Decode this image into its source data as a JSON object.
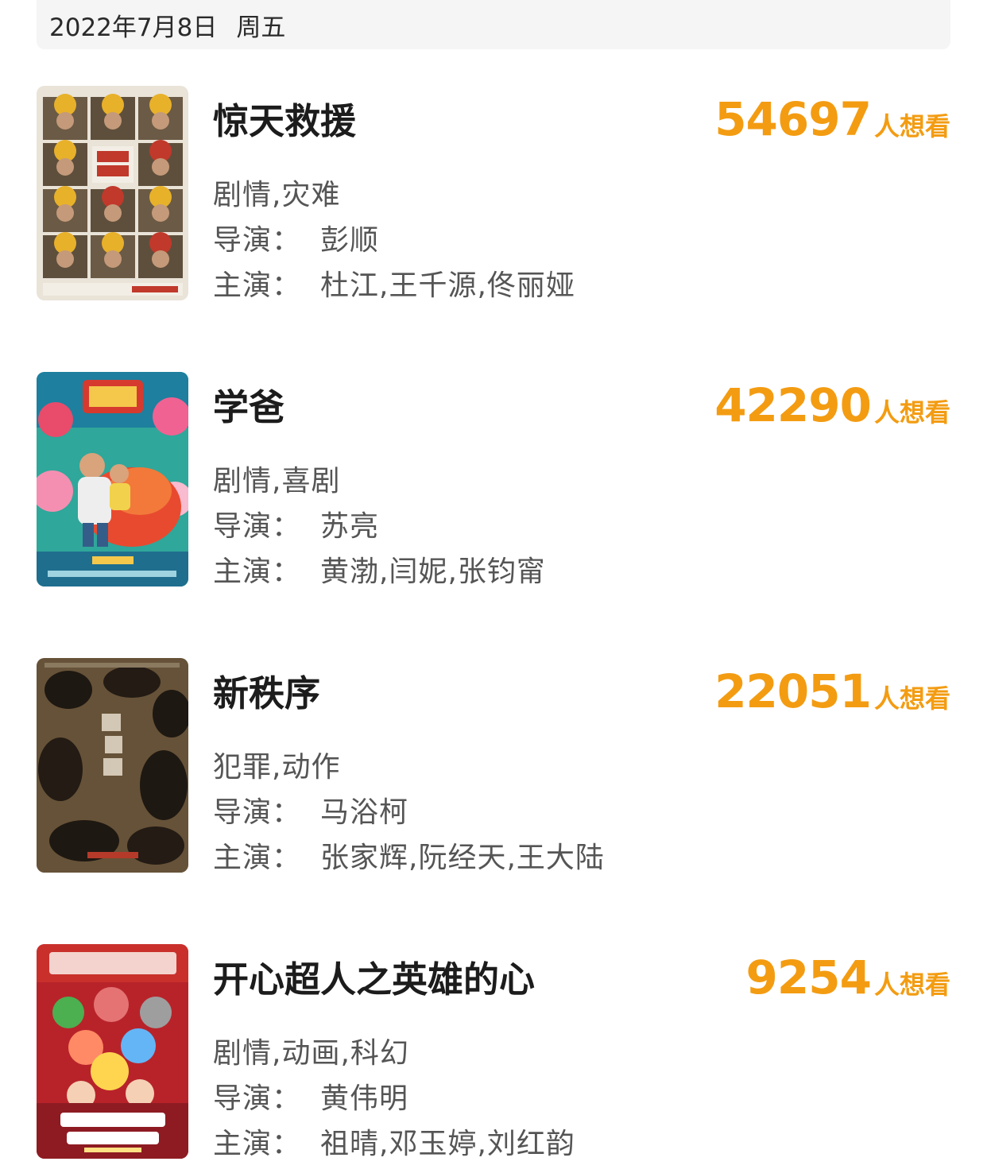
{
  "header": {
    "date": "2022年7月8日",
    "weekday": "周五"
  },
  "colors": {
    "accent": "#f39c12",
    "date_bar_bg": "#f5f5f5"
  },
  "labels": {
    "director": "导演：",
    "cast": "主演：",
    "want_suffix": "人想看"
  },
  "movies": [
    {
      "title": "惊天救援",
      "want_count": "54697",
      "genres": "剧情,灾难",
      "director": "彭顺",
      "cast": "杜江,王千源,佟丽娅",
      "poster_icon": "firefighters-poster"
    },
    {
      "title": "学爸",
      "want_count": "42290",
      "genres": "剧情,喜剧",
      "director": "苏亮",
      "cast": "黄渤,闫妮,张钧甯",
      "poster_icon": "colorful-family-poster"
    },
    {
      "title": "新秩序",
      "want_count": "22051",
      "genres": "犯罪,动作",
      "director": "马浴柯",
      "cast": "张家辉,阮经天,王大陆",
      "poster_icon": "dark-crime-poster"
    },
    {
      "title": "开心超人之英雄的心",
      "want_count": "9254",
      "genres": "剧情,动画,科幻",
      "director": "黄伟明",
      "cast": "祖晴,邓玉婷,刘红韵",
      "poster_icon": "animated-heroes-poster"
    }
  ]
}
